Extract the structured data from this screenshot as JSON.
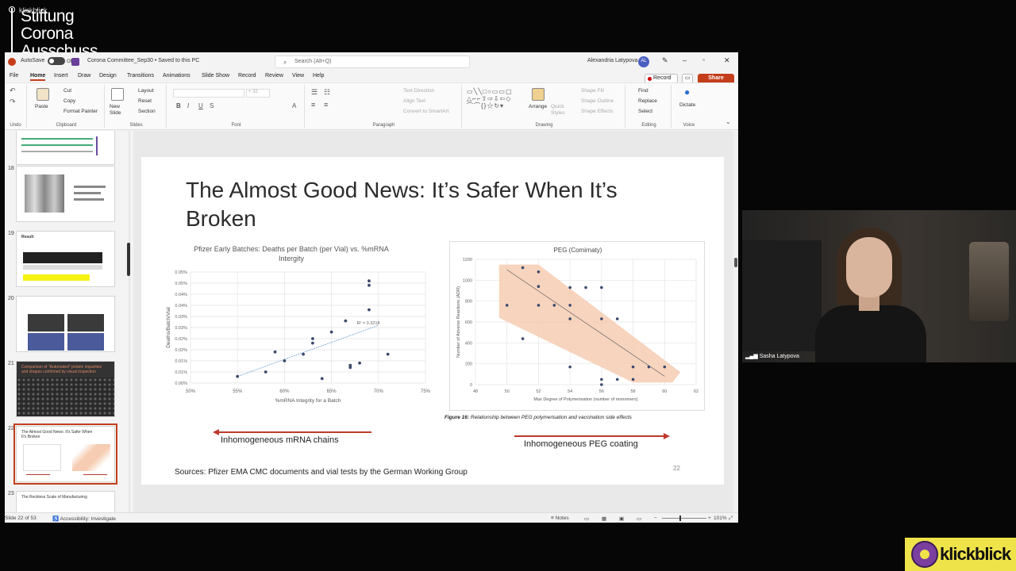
{
  "logo": {
    "small": "klickblick",
    "line1": "Stiftung",
    "line2": "Corona",
    "line3": "Ausschuss"
  },
  "titlebar": {
    "autosave": "AutoSave",
    "autosave_state": "Off",
    "doc_title": "Corona Committee_Sep30 • Saved to this PC",
    "search_placeholder": "Search (Alt+Q)",
    "user": "Alexandria Latypova",
    "user_initials": "AL"
  },
  "menu": {
    "tabs": [
      "File",
      "Home",
      "Insert",
      "Draw",
      "Design",
      "Transitions",
      "Animations",
      "Slide Show",
      "Record",
      "Review",
      "View",
      "Help"
    ],
    "active": "Home",
    "record": "Record",
    "share": "Share"
  },
  "ribbon": {
    "undo_group": "Undo",
    "clipboard": {
      "paste": "Paste",
      "cut": "Cut",
      "copy": "Copy",
      "format_painter": "Format Painter",
      "label": "Clipboard"
    },
    "slides": {
      "new_slide": "New Slide",
      "layout": "Layout",
      "reset": "Reset",
      "section": "Section",
      "label": "Slides"
    },
    "font": {
      "label": "Font",
      "size": "+ 32"
    },
    "paragraph": {
      "text_direction": "Text Direction",
      "align_text": "Align Text",
      "convert": "Convert to SmartArt",
      "label": "Paragraph"
    },
    "drawing": {
      "arrange": "Arrange",
      "quick_styles": "Quick Styles",
      "shape_fill": "Shape Fill",
      "shape_outline": "Shape Outline",
      "shape_effects": "Shape Effects",
      "label": "Drawing"
    },
    "editing": {
      "find": "Find",
      "replace": "Replace",
      "select": "Select",
      "label": "Editing"
    },
    "voice": {
      "dictate": "Dictate",
      "label": "Voice"
    }
  },
  "thumbnails": [
    {
      "num": "18",
      "text": ""
    },
    {
      "num": "19",
      "text": "Result"
    },
    {
      "num": "20",
      "text": ""
    },
    {
      "num": "21",
      "text": "Comparison of \"Automated\" protein impurities and shapes confirmed by visual inspection"
    },
    {
      "num": "22",
      "text": "The Almost Good News: It's Safer When It's Broken"
    },
    {
      "num": "23",
      "text": "The Reckless Scale of Manufacturing"
    }
  ],
  "slide": {
    "title": "The Almost Good News: It’s Safer When It’s Broken",
    "left_arrow_label": "Inhomogeneous mRNA chains",
    "right_arrow_label": "Inhomogeneous PEG coating",
    "sources": "Sources: Pfizer EMA CMC documents and vial tests by the German Working Group",
    "page_number": "22",
    "figure_caption_bold": "Figure 16:",
    "figure_caption": " Relationship between PEG polymerisation and vaccination side effects"
  },
  "chart_data": [
    {
      "type": "scatter",
      "title": "Pfizer Early Batches: Deaths per Batch (per Vial) vs. %mRNA Intergity",
      "xlabel": "%mRNA Integrity for a Batch",
      "ylabel": "Deaths/Batch/Vial",
      "xlim": [
        50,
        75
      ],
      "ylim": [
        0,
        0.05
      ],
      "x_ticks": [
        "50%",
        "55%",
        "60%",
        "65%",
        "70%",
        "75%"
      ],
      "y_ticks": [
        "0.00%",
        "0.01%",
        "0.01%",
        "0.02%",
        "0.02%",
        "0.03%",
        "0.03%",
        "0.04%",
        "0.04%",
        "0.05%",
        "0.05%"
      ],
      "trendline_label": "R² = 0.3218",
      "points": [
        {
          "x": 55.0,
          "y": 0.003
        },
        {
          "x": 58.0,
          "y": 0.005
        },
        {
          "x": 59.0,
          "y": 0.014
        },
        {
          "x": 60.0,
          "y": 0.01
        },
        {
          "x": 62.0,
          "y": 0.013
        },
        {
          "x": 63.0,
          "y": 0.018
        },
        {
          "x": 63.0,
          "y": 0.02
        },
        {
          "x": 64.0,
          "y": 0.002
        },
        {
          "x": 65.0,
          "y": 0.023
        },
        {
          "x": 66.5,
          "y": 0.028
        },
        {
          "x": 67.0,
          "y": 0.007
        },
        {
          "x": 67.0,
          "y": 0.008
        },
        {
          "x": 68.0,
          "y": 0.009
        },
        {
          "x": 69.0,
          "y": 0.033
        },
        {
          "x": 69.0,
          "y": 0.044
        },
        {
          "x": 69.0,
          "y": 0.046
        },
        {
          "x": 71.0,
          "y": 0.013
        }
      ],
      "trend": [
        [
          55,
          0.003
        ],
        [
          70,
          0.026
        ]
      ]
    },
    {
      "type": "scatter",
      "title": "PEG (Comirnaty)",
      "xlabel": "Max Degree of Polymerisation (number of monomers)",
      "ylabel": "Number of Adverse Reactions (ADR)",
      "xlim": [
        48,
        62
      ],
      "ylim": [
        0,
        1200
      ],
      "x_ticks": [
        "48",
        "50",
        "52",
        "54",
        "56",
        "58",
        "60",
        "62"
      ],
      "y_ticks": [
        "0",
        "200",
        "400",
        "600",
        "800",
        "1000",
        "1200"
      ],
      "points": [
        {
          "x": 51,
          "y": 1120
        },
        {
          "x": 52,
          "y": 1080
        },
        {
          "x": 52,
          "y": 940
        },
        {
          "x": 54,
          "y": 930
        },
        {
          "x": 55,
          "y": 930
        },
        {
          "x": 56,
          "y": 930
        },
        {
          "x": 50,
          "y": 760
        },
        {
          "x": 52,
          "y": 760
        },
        {
          "x": 53,
          "y": 760
        },
        {
          "x": 54,
          "y": 760
        },
        {
          "x": 54,
          "y": 630
        },
        {
          "x": 56,
          "y": 630
        },
        {
          "x": 57,
          "y": 630
        },
        {
          "x": 51,
          "y": 440
        },
        {
          "x": 54,
          "y": 170
        },
        {
          "x": 58,
          "y": 170
        },
        {
          "x": 59,
          "y": 170
        },
        {
          "x": 60,
          "y": 170
        },
        {
          "x": 56,
          "y": 50
        },
        {
          "x": 57,
          "y": 50
        },
        {
          "x": 58,
          "y": 50
        },
        {
          "x": 56,
          "y": 0
        }
      ],
      "trend": [
        [
          50,
          1100
        ],
        [
          60,
          80
        ]
      ]
    }
  ],
  "statusbar": {
    "slide_of": "Slide 22 of 53",
    "accessibility": "Accessibility: Investigate",
    "notes": "Notes",
    "zoom": "101%"
  },
  "webcam": {
    "name": "Sasha Latypova"
  },
  "watermark": {
    "text": "klickblick"
  },
  "colors": {
    "accent": "#c43e1c",
    "arrow": "#c0392b",
    "peg_band": "#f6cdb3",
    "point": "#3b4a6b"
  }
}
